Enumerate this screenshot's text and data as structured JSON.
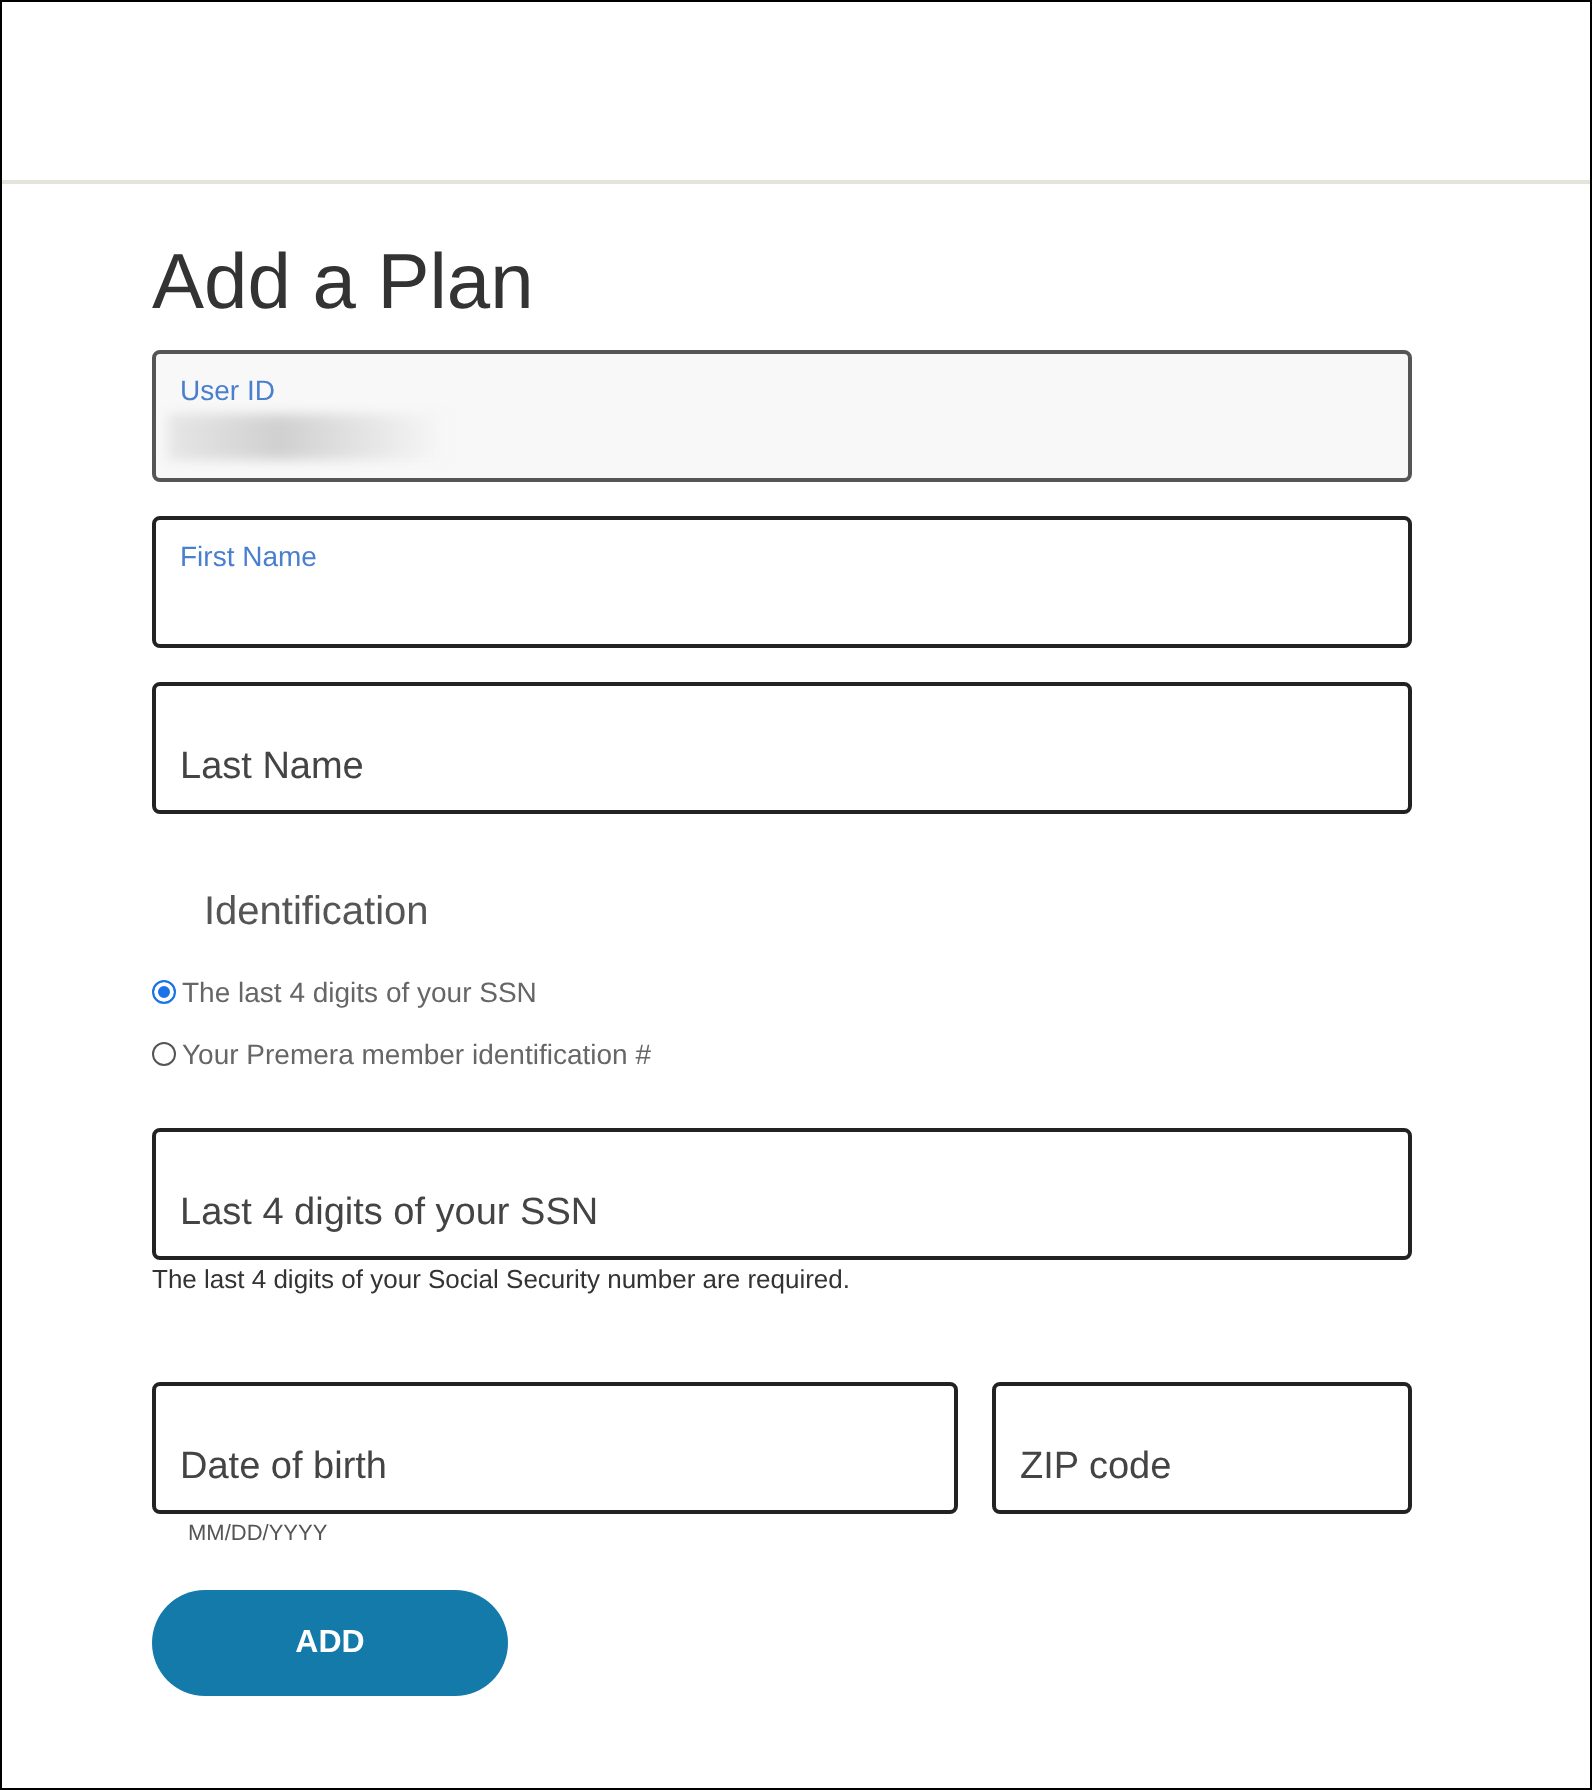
{
  "title": "Add a Plan",
  "fields": [
    {
      "label": "User ID",
      "floated": true,
      "disabled": true,
      "redacted": true
    },
    {
      "label": "First Name",
      "floated": true,
      "disabled": false,
      "redacted": false
    },
    {
      "label": "Last Name",
      "floated": false,
      "disabled": false,
      "redacted": false
    }
  ],
  "identification": {
    "heading": "Identification",
    "options": [
      {
        "label": "The last 4 digits of your SSN",
        "selected": true
      },
      {
        "label": "Your Premera member identification #",
        "selected": false
      }
    ]
  },
  "ssn_field": {
    "label": "Last 4 digits of your SSN",
    "floated": false,
    "helper": "The last 4 digits of your Social Security number are required."
  },
  "dob_field": {
    "label": "Date of birth",
    "floated": false,
    "helper": "MM/DD/YYYY"
  },
  "zip_field": {
    "label": "ZIP code",
    "floated": false
  },
  "button": "ADD"
}
